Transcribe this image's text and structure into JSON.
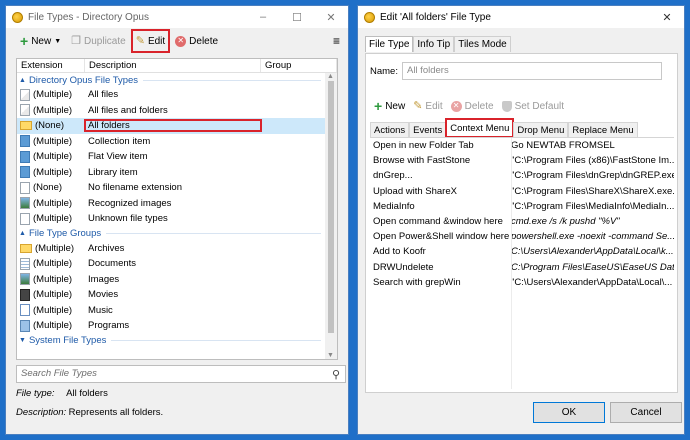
{
  "win1": {
    "title": "File Types - Directory Opus",
    "toolbar": {
      "new": "New",
      "duplicate": "Duplicate",
      "edit": "Edit",
      "delete": "Delete"
    },
    "columns": [
      "Extension",
      "Description",
      "Group"
    ],
    "groups": [
      {
        "label": "Directory Opus File Types",
        "rows": [
          {
            "ext": "(Multiple)",
            "desc": "All files",
            "icon": "multi"
          },
          {
            "ext": "(Multiple)",
            "desc": "All files and folders",
            "icon": "multi"
          },
          {
            "ext": "(None)",
            "desc": "All folders",
            "icon": "folder",
            "selected": true
          },
          {
            "ext": "(Multiple)",
            "desc": "Collection item",
            "icon": "blue"
          },
          {
            "ext": "(Multiple)",
            "desc": "Flat View item",
            "icon": "blue"
          },
          {
            "ext": "(Multiple)",
            "desc": "Library item",
            "icon": "blue"
          },
          {
            "ext": "(None)",
            "desc": "No filename extension",
            "icon": "plain"
          },
          {
            "ext": "(Multiple)",
            "desc": "Recognized images",
            "icon": "img"
          },
          {
            "ext": "(Multiple)",
            "desc": "Unknown file types",
            "icon": "plain"
          }
        ]
      },
      {
        "label": "File Type Groups",
        "rows": [
          {
            "ext": "(Multiple)",
            "desc": "Archives",
            "icon": "folder"
          },
          {
            "ext": "(Multiple)",
            "desc": "Documents",
            "icon": "doc"
          },
          {
            "ext": "(Multiple)",
            "desc": "Images",
            "icon": "img"
          },
          {
            "ext": "(Multiple)",
            "desc": "Movies",
            "icon": "movie"
          },
          {
            "ext": "(Multiple)",
            "desc": "Music",
            "icon": "music"
          },
          {
            "ext": "(Multiple)",
            "desc": "Programs",
            "icon": "prog"
          }
        ]
      },
      {
        "label": "System File Types",
        "rows": []
      }
    ],
    "search_placeholder": "Search File Types",
    "file_type_label": "File type:",
    "file_type_value": "All folders",
    "description_label": "Description:",
    "description_value": "Represents all folders."
  },
  "win2": {
    "title": "Edit 'All folders' File Type",
    "tabs": [
      "File Type",
      "Info Tip",
      "Tiles Mode"
    ],
    "name_label": "Name:",
    "name_value": "All folders",
    "toolbar": {
      "new": "New",
      "edit": "Edit",
      "delete": "Delete",
      "set_default": "Set Default"
    },
    "inner_tabs": [
      "Actions",
      "Events",
      "Context Menu",
      "Drop Menu",
      "Replace Menu"
    ],
    "menu_items": [
      {
        "name": "Open in new Folder Tab",
        "cmd": "Go NEWTAB FROMSEL",
        "italic": false
      },
      {
        "name": "Browse with FastStone",
        "cmd": "\"C:\\Program Files (x86)\\FastStone Im...",
        "italic": false
      },
      {
        "name": "dnGrep...",
        "cmd": "\"C:\\Program Files\\dnGrep\\dnGREP.exe...",
        "italic": false
      },
      {
        "name": "Upload with ShareX",
        "cmd": "\"C:\\Program Files\\ShareX\\ShareX.exe...",
        "italic": false
      },
      {
        "name": "MediaInfo",
        "cmd": "\"C:\\Program Files\\MediaInfo\\MediaIn...",
        "italic": false
      },
      {
        "name": "Open command &window here",
        "cmd": "cmd.exe /s /k pushd \"%V\"",
        "italic": true
      },
      {
        "name": "Open Power&Shell window here",
        "cmd": "powershell.exe -noexit -command Se...",
        "italic": true
      },
      {
        "name": "Add to Koofr",
        "cmd": "C:\\Users\\Alexander\\AppData\\Local\\k...",
        "italic": true
      },
      {
        "name": "DRWUndelete",
        "cmd": "C:\\Program Files\\EaseUS\\EaseUS Dat...",
        "italic": true
      },
      {
        "name": "Search with grepWin",
        "cmd": "\"C:\\Users\\Alexander\\AppData\\Local\\...",
        "italic": false
      }
    ],
    "ok": "OK",
    "cancel": "Cancel"
  },
  "colors": {
    "desktop": "#1f6fc8",
    "highlight": "#d9232b",
    "selection": "#cde8fa",
    "group_header": "#1e5aa8"
  }
}
